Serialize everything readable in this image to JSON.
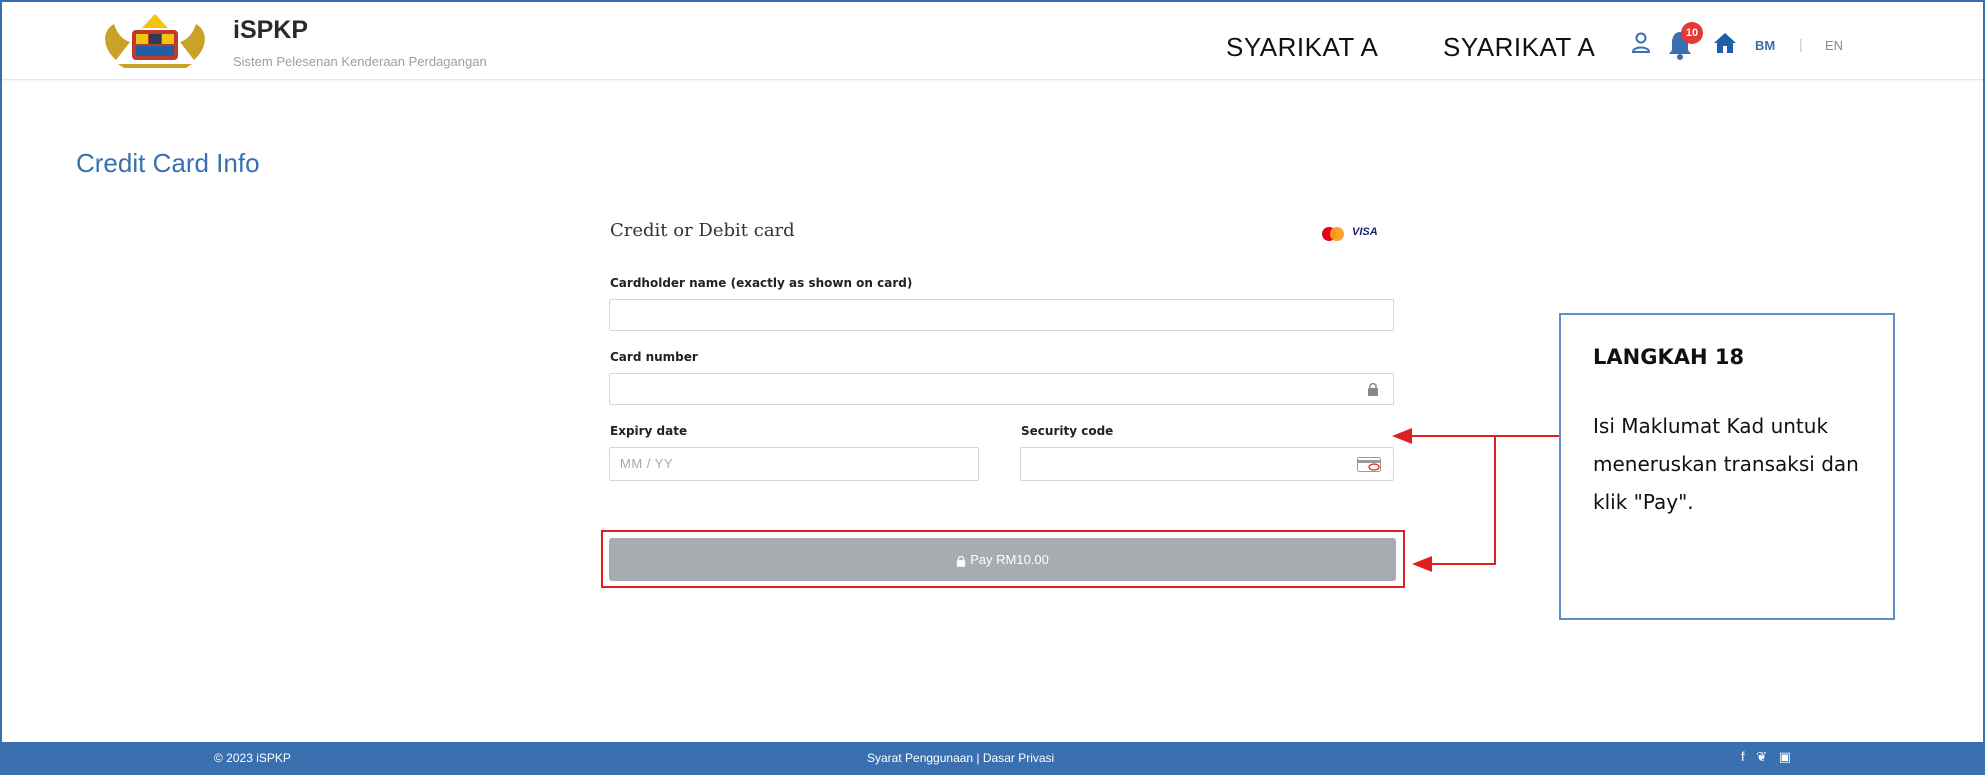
{
  "header": {
    "brand_title": "iSPKP",
    "brand_subtitle": "Sistem Pelesenan Kenderaan Perdagangan",
    "company_1": "SYARIKAT A",
    "company_2": "SYARIKAT A",
    "notification_count": "10",
    "lang_bm": "BM",
    "lang_sep": "|",
    "lang_en": "EN"
  },
  "page": {
    "title": "Credit Card Info"
  },
  "form": {
    "heading": "Credit or Debit card",
    "card_brands": [
      "mastercard-icon",
      "visa-icon"
    ],
    "visa_label": "VISA",
    "cardholder_label": "Cardholder name (exactly as shown on card)",
    "cardholder_value": "",
    "card_number_label": "Card number",
    "card_number_value": "",
    "expiry_label": "Expiry date",
    "expiry_placeholder": "MM / YY",
    "security_label": "Security code",
    "security_value": "",
    "pay_label": "Pay RM10.00"
  },
  "callout": {
    "title": "LANGKAH 18",
    "body": "Isi Maklumat Kad untuk meneruskan transaksi dan klik \"Pay\"."
  },
  "footer": {
    "copyright": "© 2023 iSPKP",
    "links": "Syarat Penggunaan | Dasar Privasi",
    "social_icons": [
      "facebook-icon",
      "twitter-icon",
      "instagram-icon"
    ],
    "social_text": "f ❦ ▣"
  },
  "colors": {
    "primary": "#3a6fb0",
    "annotation_red": "#e02020",
    "pay_button_disabled": "#a8abb0",
    "callout_border": "#5b8fd0"
  }
}
